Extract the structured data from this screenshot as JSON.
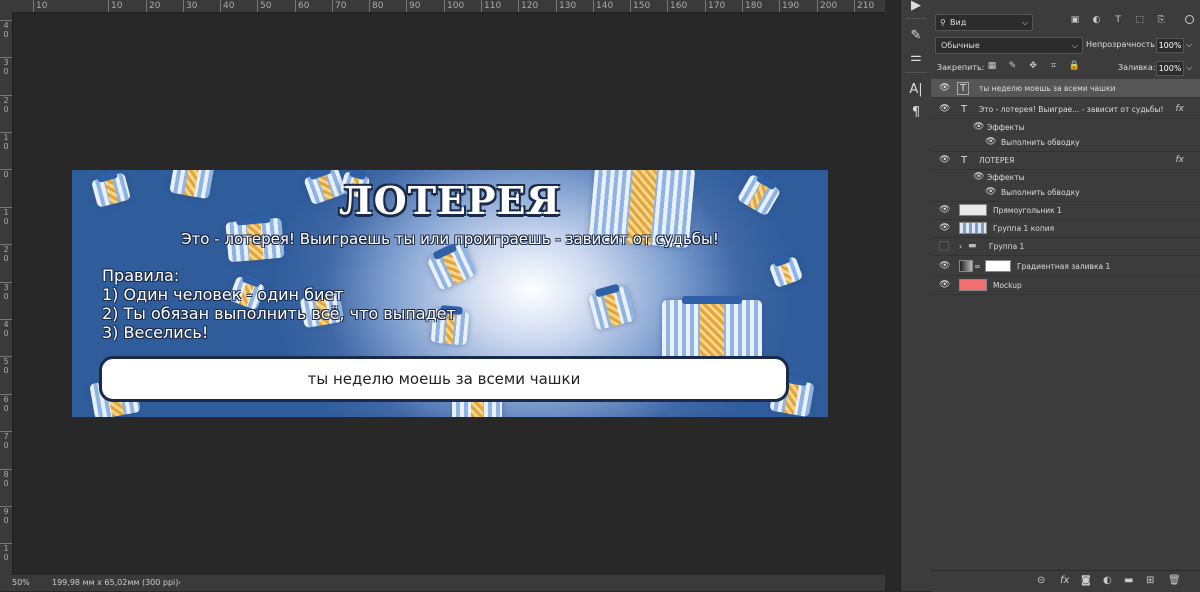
{
  "rulers": {
    "top_ticks": [
      "10",
      "10",
      "20",
      "30",
      "40",
      "50",
      "60",
      "70",
      "80",
      "90",
      "100",
      "110",
      "120",
      "130",
      "140",
      "150",
      "160",
      "170",
      "180",
      "190",
      "200",
      "210"
    ],
    "left_ticks": [
      "4 0",
      "3 0",
      "2 0",
      "1 0",
      "0",
      "1 0",
      "2 0",
      "3 0",
      "4 0",
      "5 0",
      "6 0",
      "7 0",
      "8 0",
      "9 0",
      "1 0"
    ]
  },
  "banner": {
    "title": "ЛОТЕРЕЯ",
    "subtitle": "Это - лотерея! Выиграешь ты или проиграешь - зависит от судьбы!",
    "rules": [
      "Правила:",
      "1) Один человек - один биет",
      "2) Ты обязан выполнить всё, что выпадет",
      "3) Веселись!"
    ],
    "task": "ты неделю моешь за всеми чашки"
  },
  "status_bar": {
    "zoom": "50%",
    "doc_info": "199,98 мм x 65,02мм (300 ppi)",
    "arrow": "›"
  },
  "panel": {
    "search_label": "Вид",
    "blend_mode": "Обычные",
    "opacity_label": "Непрозрачность:",
    "opacity_value": "100%",
    "lock_label": "Закрепить:",
    "fill_label": "Заливка:",
    "fill_value": "100%",
    "layers": [
      {
        "name": "ты неделю моешь за всеми чашки",
        "kind": "text"
      },
      {
        "name": "Это - лотерея! Выиграе... - зависит от судьбы!",
        "kind": "text",
        "fx": "fx"
      },
      {
        "name": "Эффекты",
        "kind": "effect"
      },
      {
        "name": "Выполнить обводку",
        "kind": "effect-item"
      },
      {
        "name": "ЛОТЕРЕЯ",
        "kind": "text",
        "fx": "fx"
      },
      {
        "name": "Эффекты",
        "kind": "effect"
      },
      {
        "name": "Выполнить обводку",
        "kind": "effect-item"
      },
      {
        "name": "Прямоугольник 1",
        "kind": "shape"
      },
      {
        "name": "Группа 1 копия",
        "kind": "image"
      },
      {
        "name": "Группа 1",
        "kind": "group"
      },
      {
        "name": "Градиентная заливка 1",
        "kind": "fill"
      },
      {
        "name": "Mockup",
        "kind": "color"
      }
    ]
  },
  "colors": {
    "app_bg": "#282828",
    "panel_bg": "#3c3c3c",
    "selected_layer": "#565656",
    "banner_blue": "#2f5d9b",
    "mockup_swatch": "#f07070"
  }
}
